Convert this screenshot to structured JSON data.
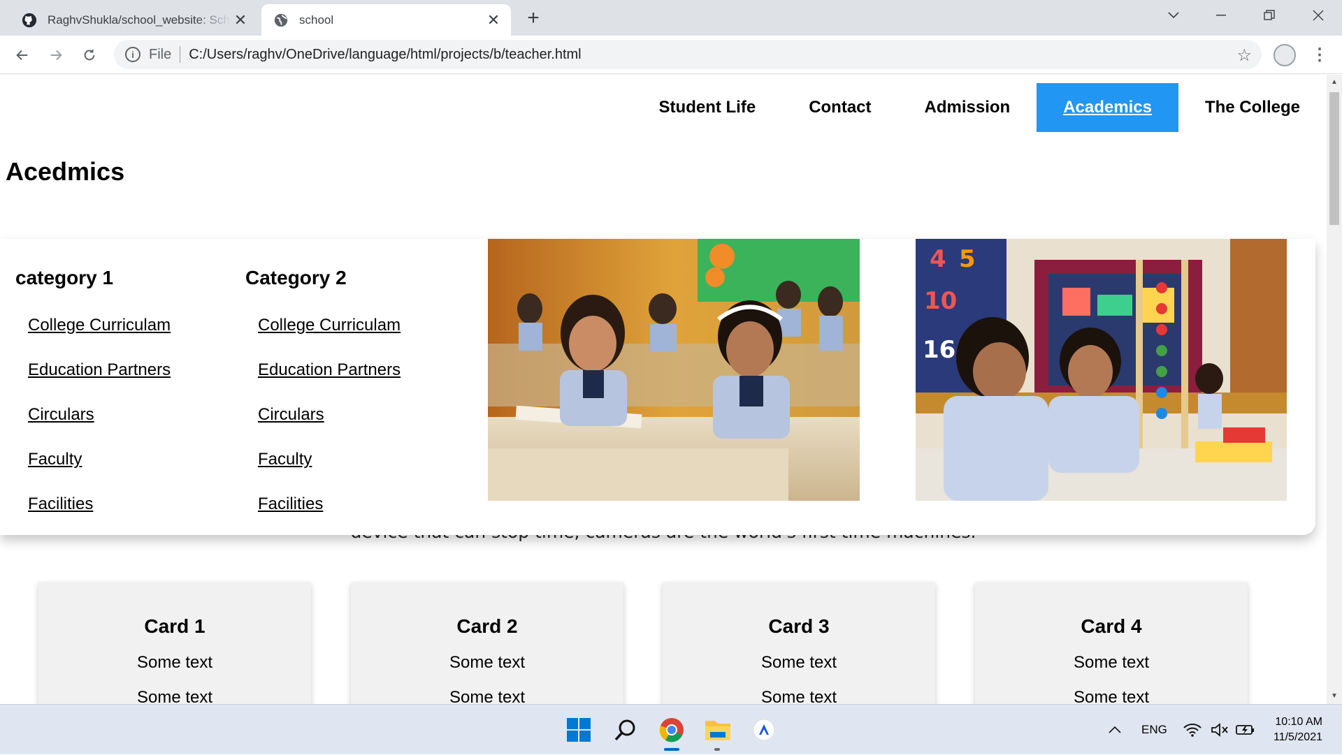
{
  "browser": {
    "tabs": [
      {
        "title": "RaghvShukla/school_website: Sch",
        "icon": "github-icon",
        "active": false
      },
      {
        "title": "school",
        "icon": "globe-icon",
        "active": true
      }
    ],
    "address": {
      "scheme": "File",
      "url": "C:/Users/raghv/OneDrive/language/html/projects/b/teacher.html"
    }
  },
  "nav": {
    "items": [
      "Student Life",
      "Contact",
      "Admission",
      "Academics",
      "The College"
    ],
    "active": "Academics"
  },
  "page": {
    "title": "Acedmics",
    "behind_text": "device that can stop time, cameras are the world's first time machines."
  },
  "dropdown": {
    "columns": [
      {
        "heading": "category 1",
        "links": [
          "College Curriculam",
          "Education Partners",
          "Circulars",
          "Faculty",
          "Facilities"
        ]
      },
      {
        "heading": "Category 2",
        "links": [
          "College Curriculam",
          "Education Partners",
          "Circulars",
          "Faculty",
          "Facilities"
        ]
      }
    ]
  },
  "cards": [
    {
      "title": "Card 1",
      "text1": "Some text",
      "text2": "Some text"
    },
    {
      "title": "Card 2",
      "text1": "Some text",
      "text2": "Some text"
    },
    {
      "title": "Card 3",
      "text1": "Some text",
      "text2": "Some text"
    },
    {
      "title": "Card 4",
      "text1": "Some text",
      "text2": "Some text"
    }
  ],
  "taskbar": {
    "language": "ENG",
    "time": "10:10 AM",
    "date": "11/5/2021"
  },
  "colors": {
    "accent": "#2196f3",
    "card_bg": "#f1f1f1"
  }
}
